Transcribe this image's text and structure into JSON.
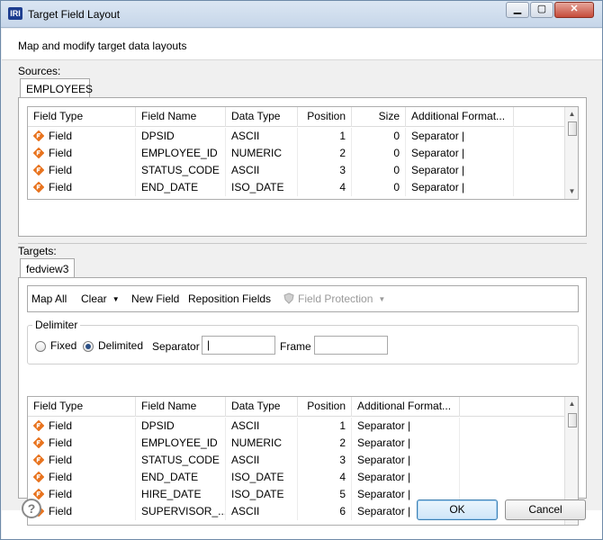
{
  "window": {
    "app_icon": "IRI",
    "title": "Target Field Layout",
    "controls": [
      "minimize-icon",
      "maximize-icon",
      "close-icon"
    ]
  },
  "header": {
    "subtitle": "Map and modify target data layouts"
  },
  "sources": {
    "label": "Sources:",
    "tab": "EMPLOYEES",
    "columns": [
      "Field Type",
      "Field Name",
      "Data Type",
      "Position",
      "Size",
      "Additional Format..."
    ],
    "rows": [
      {
        "type": "Field",
        "name": "DPSID",
        "data_type": "ASCII",
        "position": "1",
        "size": "0",
        "format": "Separator |"
      },
      {
        "type": "Field",
        "name": "EMPLOYEE_ID",
        "data_type": "NUMERIC",
        "position": "2",
        "size": "0",
        "format": "Separator |"
      },
      {
        "type": "Field",
        "name": "STATUS_CODE",
        "data_type": "ASCII",
        "position": "3",
        "size": "0",
        "format": "Separator |"
      },
      {
        "type": "Field",
        "name": "END_DATE",
        "data_type": "ISO_DATE",
        "position": "4",
        "size": "0",
        "format": "Separator |"
      }
    ]
  },
  "targets": {
    "label": "Targets:",
    "tab": "fedview3",
    "toolbar": {
      "map_all": "Map All",
      "clear": "Clear",
      "new_field": "New Field",
      "reposition": "Reposition Fields",
      "field_protection": "Field Protection"
    },
    "delimiter": {
      "label": "Delimiter",
      "fixed": "Fixed",
      "delimited": "Delimited",
      "selected": "Delimited",
      "separator_label": "Separator",
      "separator_value": "|",
      "frame_label": "Frame",
      "frame_value": ""
    },
    "columns": [
      "Field Type",
      "Field Name",
      "Data Type",
      "Position",
      "Additional Format..."
    ],
    "rows": [
      {
        "type": "Field",
        "name": "DPSID",
        "data_type": "ASCII",
        "position": "1",
        "format": "Separator |"
      },
      {
        "type": "Field",
        "name": "EMPLOYEE_ID",
        "data_type": "NUMERIC",
        "position": "2",
        "format": "Separator |"
      },
      {
        "type": "Field",
        "name": "STATUS_CODE",
        "data_type": "ASCII",
        "position": "3",
        "format": "Separator |"
      },
      {
        "type": "Field",
        "name": "END_DATE",
        "data_type": "ISO_DATE",
        "position": "4",
        "format": "Separator |"
      },
      {
        "type": "Field",
        "name": "HIRE_DATE",
        "data_type": "ISO_DATE",
        "position": "5",
        "format": "Separator |"
      },
      {
        "type": "Field",
        "name": "SUPERVISOR_...",
        "data_type": "ASCII",
        "position": "6",
        "format": "Separator |"
      }
    ]
  },
  "footer": {
    "help": "?",
    "ok": "OK",
    "cancel": "Cancel"
  },
  "colors": {
    "field_icon": "#e8731e",
    "default_button_border": "#3c7fb1"
  }
}
